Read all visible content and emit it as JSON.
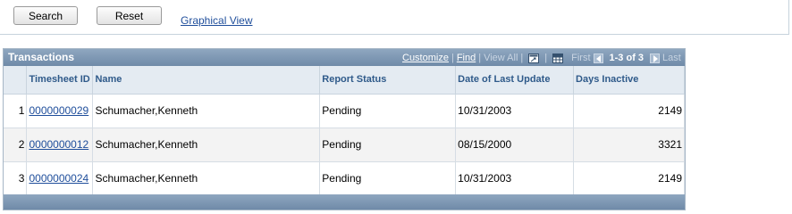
{
  "toolbar": {
    "search_label": "Search",
    "reset_label": "Reset",
    "graphical_view_label": "Graphical View"
  },
  "grid": {
    "title": "Transactions",
    "nav": {
      "customize": "Customize",
      "find": "Find",
      "view_all": "View All",
      "first": "First",
      "count": "1-3 of 3",
      "last": "Last"
    },
    "columns": [
      "Timesheet ID",
      "Name",
      "Report Status",
      "Date of Last Update",
      "Days Inactive"
    ],
    "rows": [
      {
        "n": "1",
        "id": "0000000029",
        "name": "Schumacher,Kenneth",
        "status": "Pending",
        "date": "10/31/2003",
        "days": "2149"
      },
      {
        "n": "2",
        "id": "0000000012",
        "name": "Schumacher,Kenneth",
        "status": "Pending",
        "date": "08/15/2000",
        "days": "3321"
      },
      {
        "n": "3",
        "id": "0000000024",
        "name": "Schumacher,Kenneth",
        "status": "Pending",
        "date": "10/31/2003",
        "days": "2149"
      }
    ]
  },
  "icons": [
    "zoom-grid-icon",
    "download-grid-icon",
    "prev-arrow-icon",
    "next-arrow-icon"
  ],
  "colors": {
    "header": "#7891ae",
    "link": "#1f4e9b",
    "column_header_text": "#2f5a8a"
  }
}
